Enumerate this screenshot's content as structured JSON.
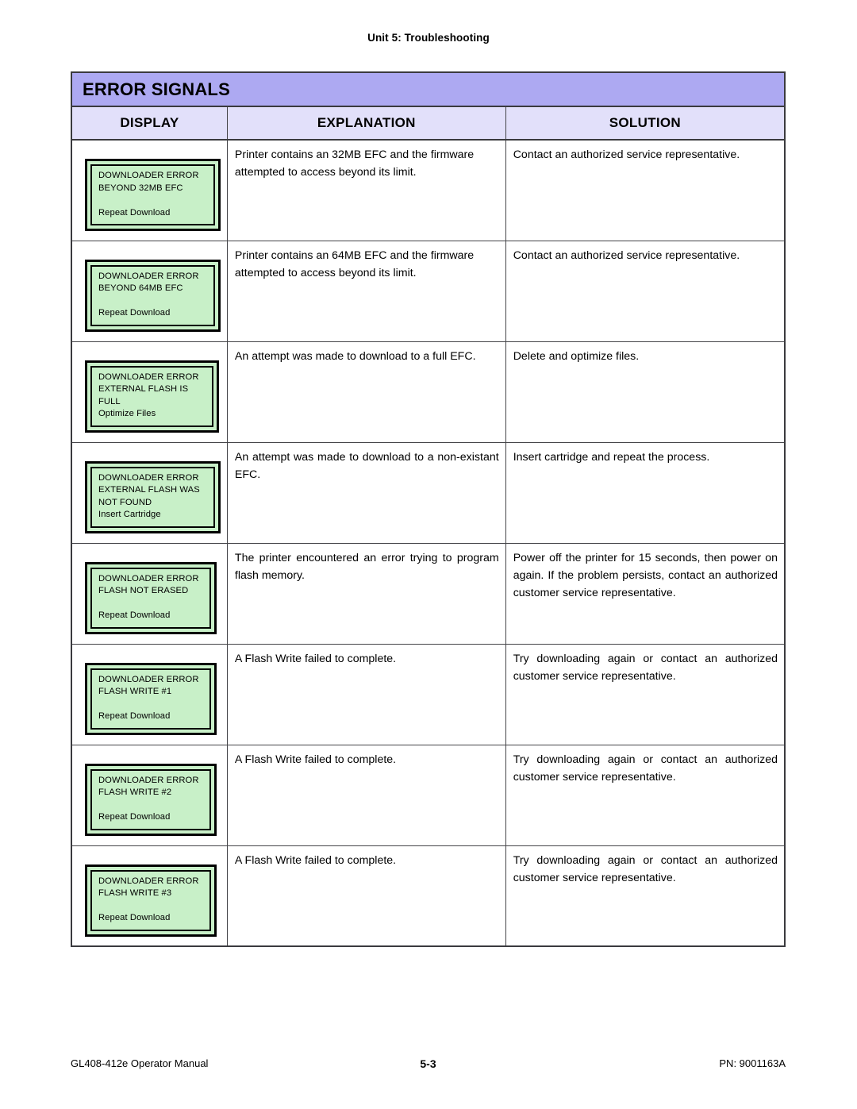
{
  "running_head": "Unit 5:  Troubleshooting",
  "table": {
    "title": "ERROR SIGNALS",
    "headers": {
      "display": "DISPLAY",
      "explanation": "EXPLANATION",
      "solution": "SOLUTION"
    },
    "rows": [
      {
        "display_lines": [
          "DOWNLOADER ERROR",
          "BEYOND 32MB EFC",
          "",
          "Repeat Download"
        ],
        "explanation": "Printer contains an 32MB EFC and the firmware attempted to access beyond its limit.",
        "solution": "Contact an authorized service representative."
      },
      {
        "display_lines": [
          "DOWNLOADER ERROR",
          "BEYOND 64MB EFC",
          "",
          "Repeat Download"
        ],
        "explanation": "Printer contains an 64MB EFC and the firmware attempted to access beyond its limit.",
        "solution": "Contact an authorized service representative."
      },
      {
        "display_lines": [
          "DOWNLOADER ERROR",
          "EXTERNAL FLASH IS",
          "FULL",
          "Optimize Files"
        ],
        "explanation": "An attempt was made to download to a full EFC.",
        "solution": "Delete and optimize files."
      },
      {
        "display_lines": [
          "DOWNLOADER ERROR",
          "EXTERNAL FLASH WAS",
          "NOT FOUND",
          "Insert Cartridge"
        ],
        "explanation": "An attempt was made to download to a non-existant EFC.",
        "solution": "Insert cartridge and repeat the process."
      },
      {
        "display_lines": [
          "DOWNLOADER ERROR",
          "FLASH NOT ERASED",
          "",
          "Repeat Download"
        ],
        "explanation": "The printer encountered an error trying to program flash memory.",
        "solution": "Power off the printer for 15 seconds, then power on again. If the problem persists, contact an authorized customer service representative."
      },
      {
        "display_lines": [
          "DOWNLOADER ERROR",
          "FLASH WRITE #1",
          "",
          "Repeat Download"
        ],
        "explanation": "A Flash Write failed to complete.",
        "solution": "Try downloading again or contact an authorized customer service representative."
      },
      {
        "display_lines": [
          "DOWNLOADER ERROR",
          "FLASH WRITE #2",
          "",
          "Repeat Download"
        ],
        "explanation": "A Flash Write failed to complete.",
        "solution": "Try downloading again or contact an authorized customer service representative."
      },
      {
        "display_lines": [
          "DOWNLOADER ERROR",
          "FLASH WRITE #3",
          "",
          "Repeat Download"
        ],
        "explanation": "A Flash Write failed to complete.",
        "solution": "Try downloading again or contact an authorized customer service representative."
      }
    ]
  },
  "footer": {
    "left": "GL408-412e Operator Manual",
    "center": "5-3",
    "right": "PN: 9001163A"
  },
  "colors": {
    "title_band": "#ADA9F2",
    "header_band": "#E2E0FA",
    "lcd_screen": "#C8F0C8",
    "rule": "#444448"
  }
}
